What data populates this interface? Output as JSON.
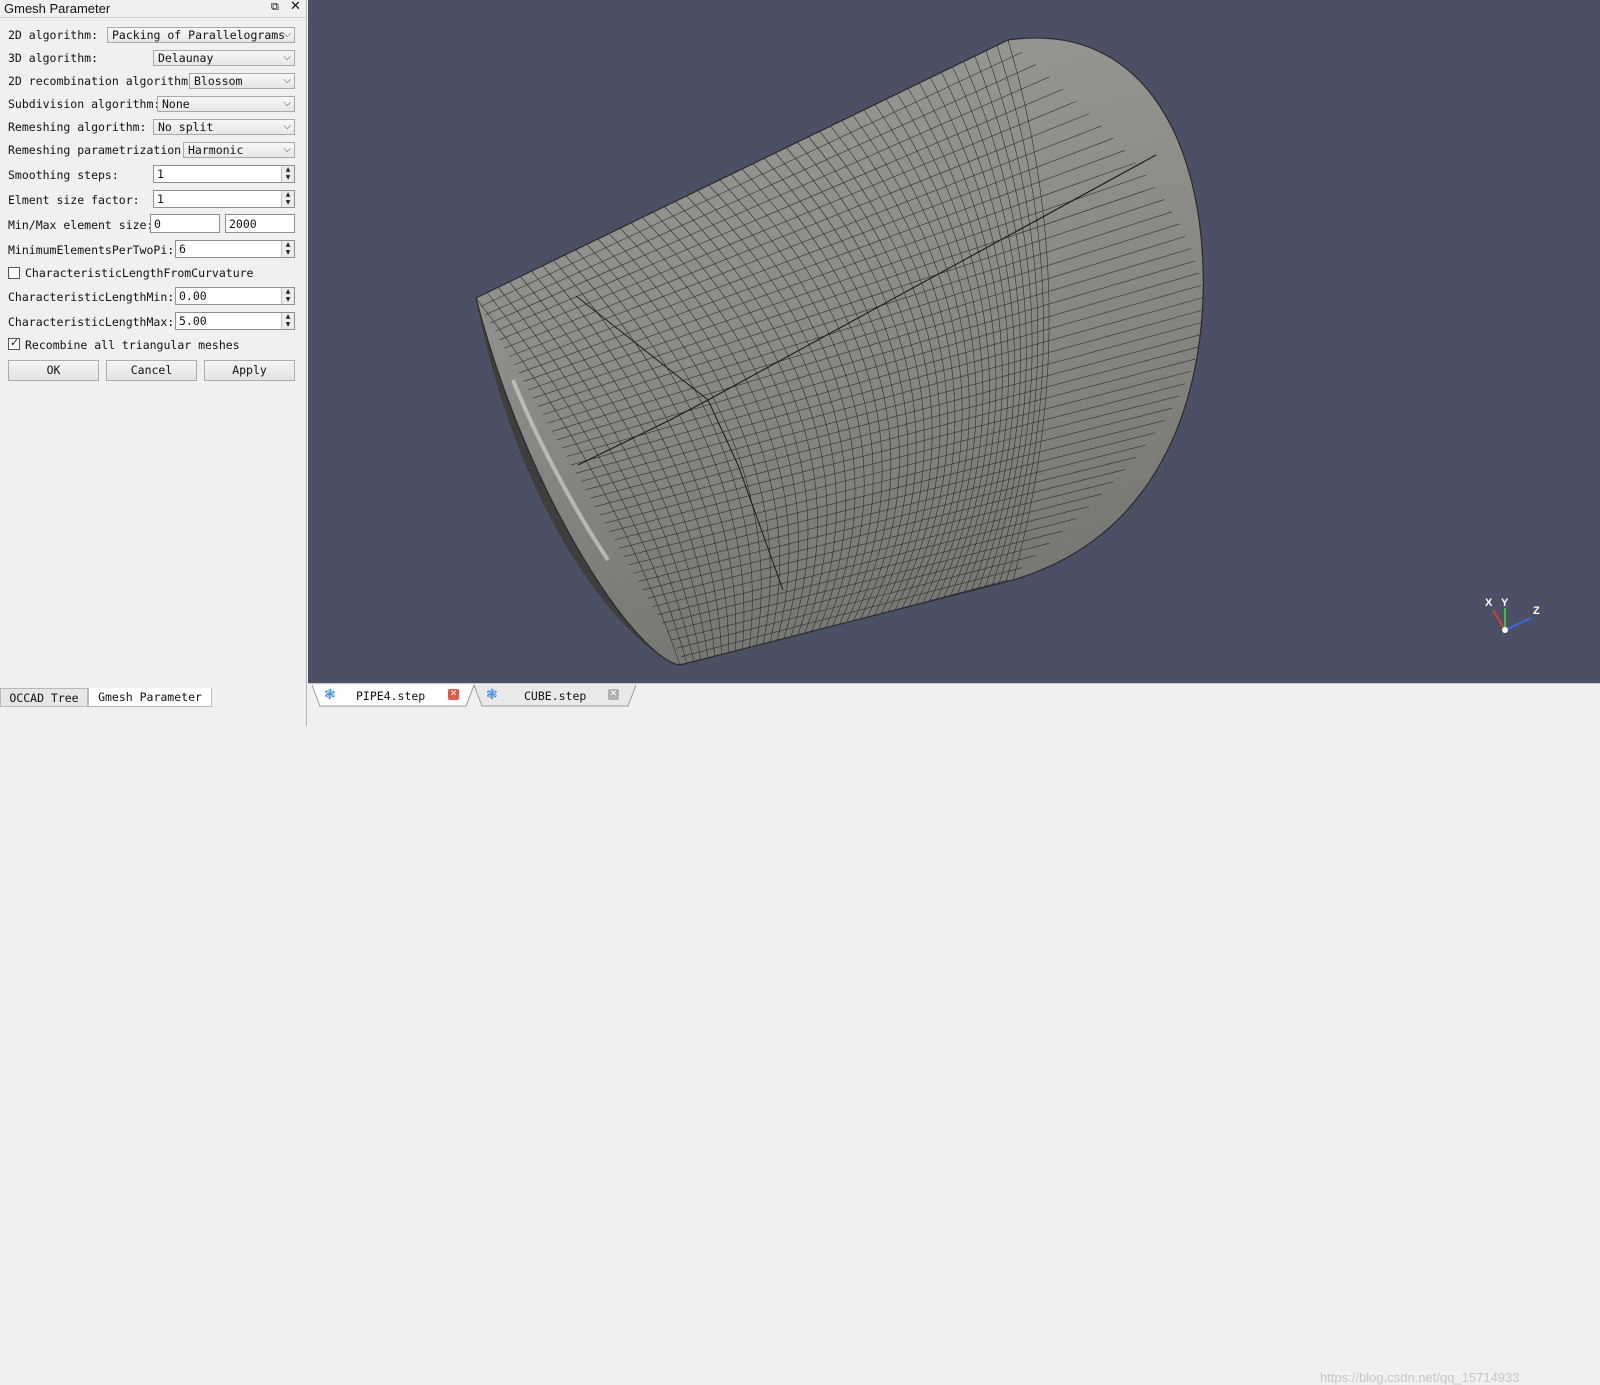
{
  "panel": {
    "title": "Gmesh Parameter",
    "float_icon": "⧉",
    "close_icon": "✕",
    "alg2d_label": "2D algorithm:",
    "alg2d_value": "Packing of Parallelograms",
    "alg3d_label": "3D algorithm:",
    "alg3d_value": "Delaunay",
    "recomb_label": "2D recombination algorithm:",
    "recomb_value": "Blossom",
    "subdiv_label": "Subdivision algorithm:",
    "subdiv_value": "None",
    "remesh_label": "Remeshing algorithm:",
    "remesh_value": "No split",
    "remeshparam_label": "Remeshing parametrization:",
    "remeshparam_value": "Harmonic",
    "smooth_label": "Smoothing steps:",
    "smooth_value": "1",
    "sizefactor_label": "Elment size factor:",
    "sizefactor_value": "1",
    "minmax_label": "Min/Max element size:",
    "min_value": "0",
    "max_value": "2000",
    "minelems_label": "MinimumElementsPerTwoPi:",
    "minelems_value": "6",
    "curv_label": "CharacteristicLengthFromCurvature",
    "curv_checked": false,
    "clmin_label": "CharacteristicLengthMin:",
    "clmin_value": "0.00",
    "clmax_label": "CharacteristicLengthMax:",
    "clmax_value": "5.00",
    "recombine_label": "Recombine all triangular meshes",
    "recombine_checked": true,
    "ok_label": "OK",
    "cancel_label": "Cancel",
    "apply_label": "Apply"
  },
  "bottom_tabs": {
    "tree": "OCCAD Tree",
    "gmesh": "Gmesh Parameter"
  },
  "doc_tabs": [
    {
      "name": "PIPE4.step",
      "active": true
    },
    {
      "name": "CUBE.step",
      "active": false
    }
  ],
  "axes": {
    "x": "X",
    "y": "Y",
    "z": "Z"
  },
  "watermark": "https://blog.csdn.net/qq_15714933",
  "colors": {
    "viewport_bg": "#4b5065",
    "mesh_face": "#8a8a86",
    "mesh_line": "#2a2a2a",
    "tab_close_active": "#e05a4a",
    "tab_close_inactive": "#b0b0b0"
  }
}
